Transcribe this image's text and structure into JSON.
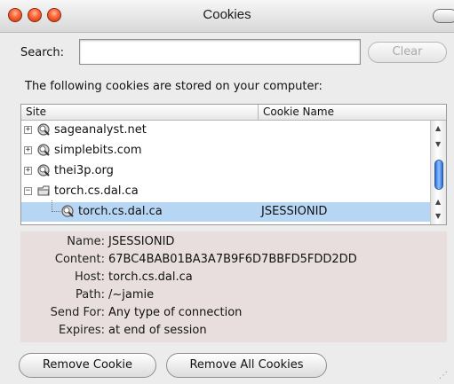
{
  "window": {
    "title": "Cookies"
  },
  "search": {
    "label": "Search:",
    "value": "",
    "clear_label": "Clear"
  },
  "info_text": "The following cookies are stored on your computer:",
  "table": {
    "columns": [
      "Site",
      "Cookie Name"
    ],
    "rows": [
      {
        "site": "sageanalyst.net",
        "cookie": "",
        "expander": "+"
      },
      {
        "site": "simplebits.com",
        "cookie": "",
        "expander": "+"
      },
      {
        "site": "thei3p.org",
        "cookie": "",
        "expander": "+"
      },
      {
        "site": "torch.cs.dal.ca",
        "cookie": "",
        "expander": "−"
      },
      {
        "site": "torch.cs.dal.ca",
        "cookie": "JSESSIONID",
        "expander": ""
      }
    ]
  },
  "details": {
    "labels": {
      "name": "Name:",
      "content": "Content:",
      "host": "Host:",
      "path": "Path:",
      "send_for": "Send For:",
      "expires": "Expires:"
    },
    "name": "JSESSIONID",
    "content": "67BC4BAB01BA3A7B9F6D7BBFD5FDD2DD",
    "host": "torch.cs.dal.ca",
    "path": "/~jamie",
    "send_for": "Any type of connection",
    "expires": "at end of session"
  },
  "buttons": {
    "remove_cookie": "Remove Cookie",
    "remove_all": "Remove All Cookies"
  },
  "icons": {
    "site": "site-magnifier-icon",
    "folder": "folder-open-icon"
  },
  "colors": {
    "selection": "#b7d6f4",
    "details_bg": "#e8dede",
    "scroll_thumb": "#2a6fd6"
  }
}
